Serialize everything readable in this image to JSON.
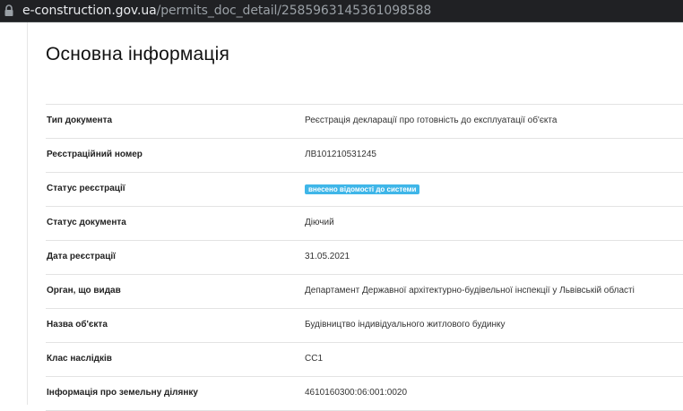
{
  "browser": {
    "url_domain": "e-construction.gov.ua",
    "url_path": "/permits_doc_detail/2585963145361098588",
    "icons": {
      "secure": "lock-icon"
    }
  },
  "section": {
    "title": "Основна інформація"
  },
  "colors": {
    "badge": "#3fb6e8",
    "divider": "#e3e3e3"
  },
  "rows": [
    {
      "label": "Тип документа",
      "value": "Реєстрація декларації про готовність до експлуатації об'єкта"
    },
    {
      "label": "Реєстраційний номер",
      "value": "ЛВ101210531245"
    },
    {
      "label": "Статус реєстрації",
      "value": "внесено відомості до системи"
    },
    {
      "label": "Статус документа",
      "value": "Діючий"
    },
    {
      "label": "Дата реєстрації",
      "value": "31.05.2021"
    },
    {
      "label": "Орган, що видав",
      "value": "Департамент Державної архітектурно-будівельної інспекції у Львівській області"
    },
    {
      "label": "Назва об'єкта",
      "value": "Будівництво індивідуального житлового будинку"
    },
    {
      "label": "Клас наслідків",
      "value": "СС1"
    },
    {
      "label": "Інформація про земельну ділянку",
      "value": "4610160300:06:001:0020"
    }
  ]
}
